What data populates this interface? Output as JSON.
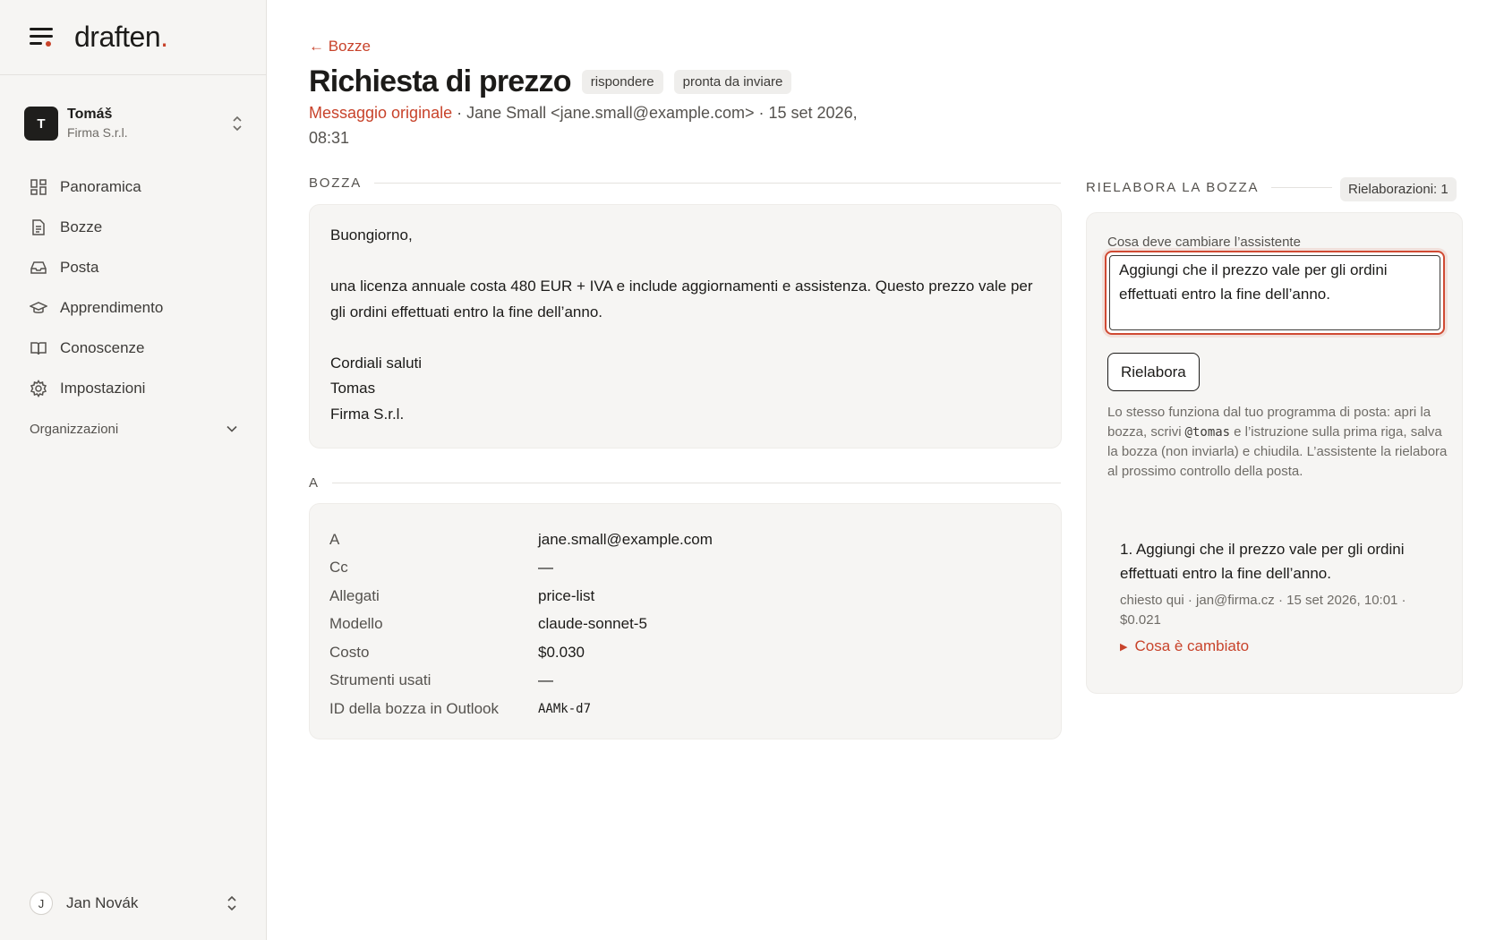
{
  "brand": {
    "name": "draften",
    "dot": "."
  },
  "account": {
    "initial": "T",
    "name": "Tomáš",
    "org": "Firma S.r.l."
  },
  "nav": [
    {
      "label": "Panoramica",
      "icon": "grid-icon"
    },
    {
      "label": "Bozze",
      "icon": "document-icon"
    },
    {
      "label": "Posta",
      "icon": "inbox-icon"
    },
    {
      "label": "Apprendimento",
      "icon": "graduation-cap-icon"
    },
    {
      "label": "Conoscenze",
      "icon": "book-icon"
    },
    {
      "label": "Impostazioni",
      "icon": "gear-icon"
    }
  ],
  "organizations": {
    "label": "Organizzazioni"
  },
  "user": {
    "initial": "J",
    "name": "Jan Novák"
  },
  "header": {
    "back": "← Bozze",
    "title": "Richiesta di prezzo",
    "badges": [
      "rispondere",
      "pronta da inviare"
    ],
    "original_link": "Messaggio originale",
    "meta": " · Jane Small <jane.small@example.com> · 15 set 2026, 08:31"
  },
  "draft": {
    "section_label": "BOZZA",
    "body": "Buongiorno,\n\nuna licenza annuale costa 480 EUR + IVA e include aggiornamenti e assistenza. Questo prezzo vale per gli ordini effettuati entro la fine dell’anno.\n\nCordiali saluti\nTomas\nFirma S.r.l."
  },
  "details": {
    "section_label": "A",
    "rows": [
      {
        "key": "A",
        "value": "jane.small@example.com"
      },
      {
        "key": "Cc",
        "value": "—"
      },
      {
        "key": "Allegati",
        "value": "price-list"
      },
      {
        "key": "Modello",
        "value": "claude-sonnet-5"
      },
      {
        "key": "Costo",
        "value": "$0.030"
      },
      {
        "key": "Strumenti usati",
        "value": "—"
      },
      {
        "key": "ID della bozza in Outlook",
        "value": "AAMk-d7"
      }
    ]
  },
  "rework": {
    "section_label": "RIELABORA LA BOZZA",
    "count_badge": "Rielaborazioni: 1",
    "field_label": "Cosa deve cambiare l’assistente",
    "field_value": "Aggiungi che il prezzo vale per gli ordini effettuati entro la fine dell’anno.",
    "button": "Rielabora",
    "help_before": "Lo stesso funziona dal tuo programma di posta: apri la bozza, scrivi",
    "help_code": "@tomas",
    "help_after": "e l’istruzione sulla prima riga, salva la bozza (non inviarla) e chiudila. L’assistente la rielabora al prossimo controllo della posta.",
    "history": [
      {
        "title": "1. Aggiungi che il prezzo vale per gli ordini effettuati entro la fine dell’anno.",
        "meta": "chiesto qui · jan@firma.cz · 15 set 2026, 10:01 · $0.021",
        "toggle": "Cosa è cambiato"
      }
    ]
  },
  "colors": {
    "accent": "#c8432b",
    "panel": "#f6f5f3",
    "text": "#1c1b19"
  }
}
